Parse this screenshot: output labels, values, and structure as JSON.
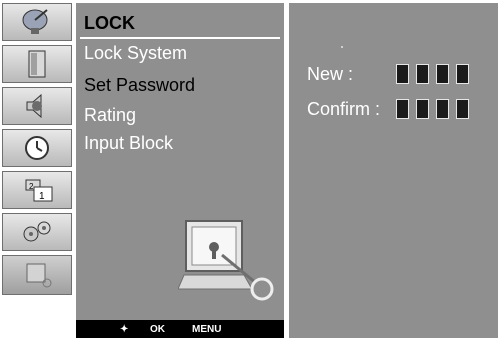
{
  "menu": {
    "title": "LOCK",
    "items": [
      {
        "label": "Lock System",
        "state": "normal"
      },
      {
        "label": "Set Password",
        "state": "selected"
      },
      {
        "label": "Rating",
        "state": "normal"
      },
      {
        "label": "Input Block",
        "state": "normal"
      }
    ],
    "nav": {
      "arrows": "✦",
      "ok": "OK",
      "menu": "MENU"
    }
  },
  "password": {
    "new_label": "New :",
    "confirm_label": "Confirm :"
  },
  "icons": [
    "satellite-dish-icon",
    "door-icon",
    "speaker-icon",
    "clock-icon",
    "picture-in-picture-icon",
    "gears-icon",
    "lock-monitor-icon"
  ]
}
